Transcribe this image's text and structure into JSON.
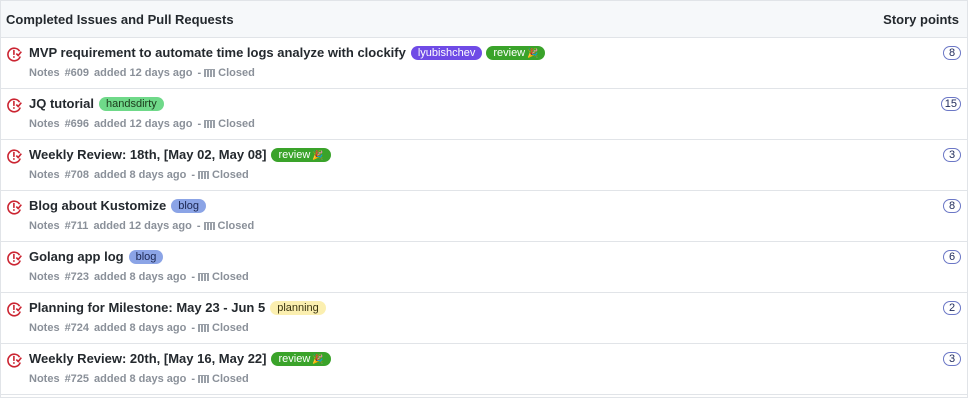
{
  "header": {
    "title": "Completed Issues and Pull Requests",
    "points_label": "Story points"
  },
  "issues": [
    {
      "title": "MVP requirement to automate time logs analyze with clockify",
      "labels": [
        {
          "text": "lyubishchev",
          "bg": "#6f4be6",
          "fg": "#ffffff",
          "emoji": ""
        },
        {
          "text": "review",
          "bg": "#3aa32a",
          "fg": "#ffffff",
          "emoji": "🎉"
        }
      ],
      "repo": "Notes",
      "number": "#609",
      "added": "added 12 days ago",
      "status": "Closed",
      "points": "8"
    },
    {
      "title": "JQ tutorial",
      "labels": [
        {
          "text": "handsdirty",
          "bg": "#6fd989",
          "fg": "#1b3a1b",
          "emoji": ""
        }
      ],
      "repo": "Notes",
      "number": "#696",
      "added": "added 12 days ago",
      "status": "Closed",
      "points": "15"
    },
    {
      "title": "Weekly Review: 18th, [May 02, May 08]",
      "labels": [
        {
          "text": "review",
          "bg": "#3aa32a",
          "fg": "#ffffff",
          "emoji": "🎉"
        }
      ],
      "repo": "Notes",
      "number": "#708",
      "added": "added 8 days ago",
      "status": "Closed",
      "points": "3"
    },
    {
      "title": "Blog about Kustomize",
      "labels": [
        {
          "text": "blog",
          "bg": "#8ba4e6",
          "fg": "#1b2650",
          "emoji": ""
        }
      ],
      "repo": "Notes",
      "number": "#711",
      "added": "added 12 days ago",
      "status": "Closed",
      "points": "8"
    },
    {
      "title": "Golang app log",
      "labels": [
        {
          "text": "blog",
          "bg": "#8ba4e6",
          "fg": "#1b2650",
          "emoji": ""
        }
      ],
      "repo": "Notes",
      "number": "#723",
      "added": "added 8 days ago",
      "status": "Closed",
      "points": "6"
    },
    {
      "title": "Planning for Milestone: May 23 - Jun 5",
      "labels": [
        {
          "text": "planning",
          "bg": "#fbefb0",
          "fg": "#3a3410",
          "emoji": ""
        }
      ],
      "repo": "Notes",
      "number": "#724",
      "added": "added 8 days ago",
      "status": "Closed",
      "points": "2"
    },
    {
      "title": "Weekly Review: 20th, [May 16, May 22]",
      "labels": [
        {
          "text": "review",
          "bg": "#3aa32a",
          "fg": "#ffffff",
          "emoji": "🎉"
        }
      ],
      "repo": "Notes",
      "number": "#725",
      "added": "added 8 days ago",
      "status": "Closed",
      "points": "3"
    }
  ]
}
